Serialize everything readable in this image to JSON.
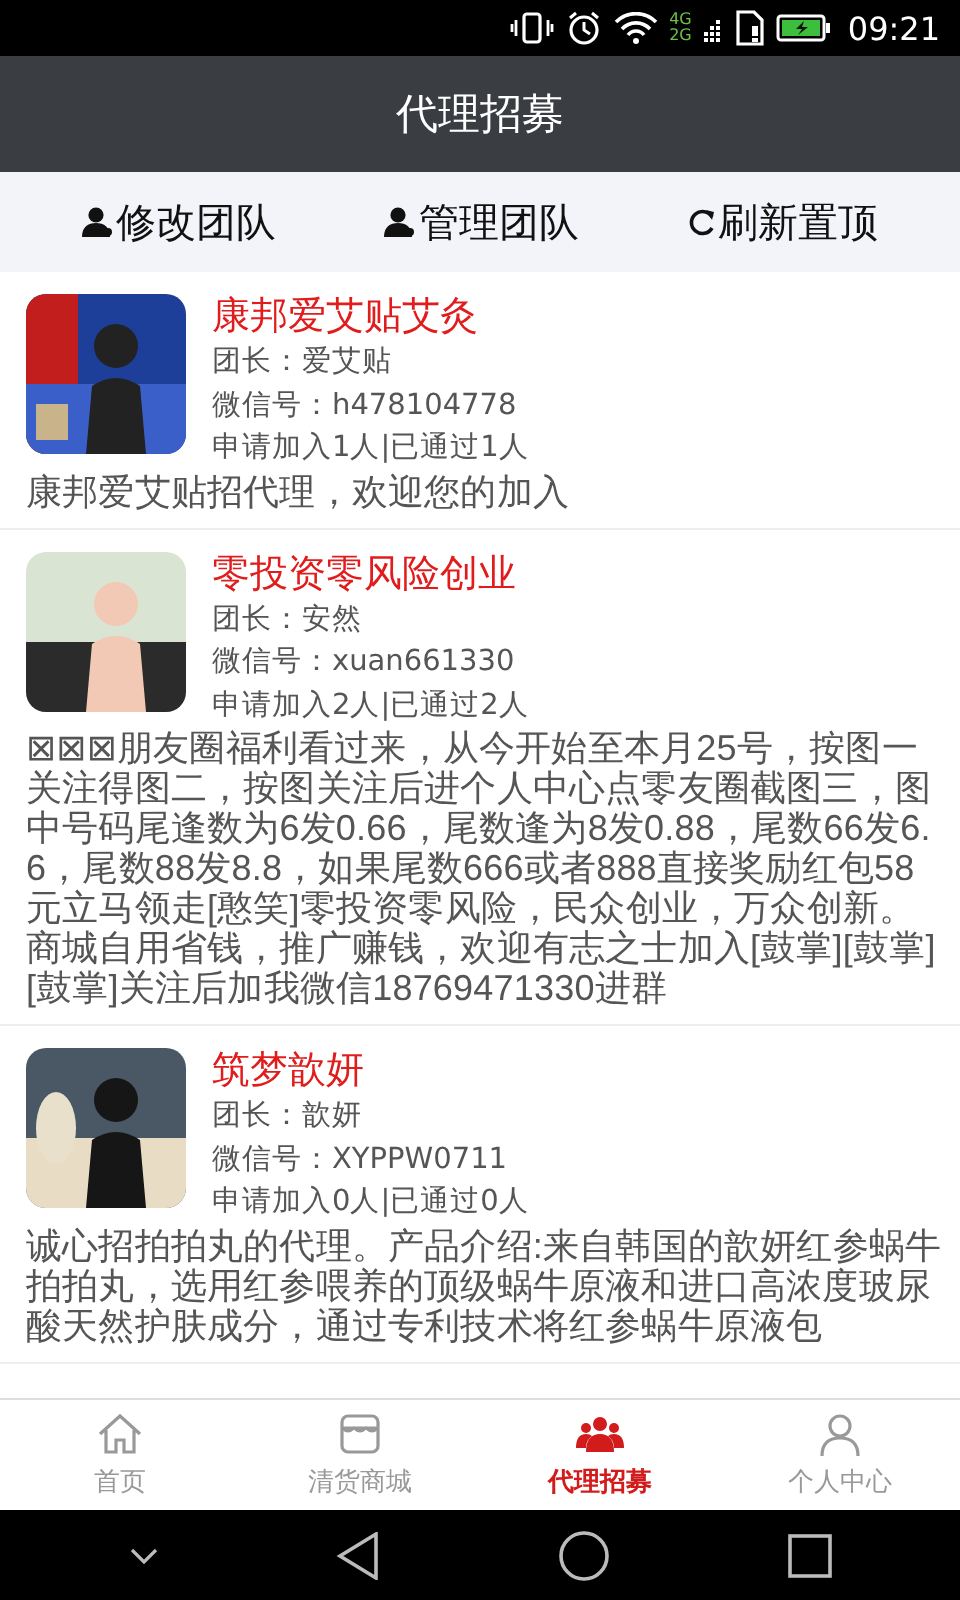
{
  "status_bar": {
    "network_top": "4G",
    "network_bottom": "2G",
    "time": "09:21"
  },
  "header": {
    "title": "代理招募"
  },
  "actions": [
    {
      "kind": "person",
      "label": "修改团队"
    },
    {
      "kind": "person",
      "label": "管理团队"
    },
    {
      "kind": "refresh",
      "label": "刷新置顶"
    }
  ],
  "teams": [
    {
      "name": "康邦爱艾贴艾灸",
      "leader": "团长：爱艾贴",
      "wechat": "微信号：h478104778",
      "stats": "申请加入1人|已通过1人",
      "description": "康邦爱艾贴招代理，欢迎您的加入"
    },
    {
      "name": "零投资零风险创业",
      "leader": "团长：安然",
      "wechat": "微信号：xuan661330",
      "stats": "申请加入2人|已通过2人",
      "description": "⊠⊠⊠朋友圈福利看过来，从今开始至本月25号，按图一关注得图二，按图关注后进个人中心点零友圈截图三，图中号码尾逢数为6发0.66，尾数逢为8发0.88，尾数66发6.6，尾数88发8.8，如果尾数666或者888直接奖励红包58元立马领走[憨笑]零投资零风险，民众创业，万众创新。商城自用省钱，推广赚钱，欢迎有志之士加入[鼓掌][鼓掌][鼓掌]关注后加我微信18769471330进群"
    },
    {
      "name": "筑梦歆妍",
      "leader": "团长：歆妍",
      "wechat": "微信号：XYPPW0711",
      "stats": "申请加入0人|已通过0人",
      "description": "诚心招拍拍丸的代理。产品介绍:来自韩国的歆妍红参蜗牛拍拍丸，选用红参喂养的顶级蜗牛原液和进口高浓度玻尿酸天然护肤成分，通过专利技术将红参蜗牛原液包"
    }
  ],
  "tabs": [
    {
      "kind": "home",
      "label": "首页",
      "selected": false
    },
    {
      "kind": "shop",
      "label": "清货商城",
      "selected": false
    },
    {
      "kind": "group",
      "label": "代理招募",
      "selected": true
    },
    {
      "kind": "person",
      "label": "个人中心",
      "selected": false
    }
  ]
}
